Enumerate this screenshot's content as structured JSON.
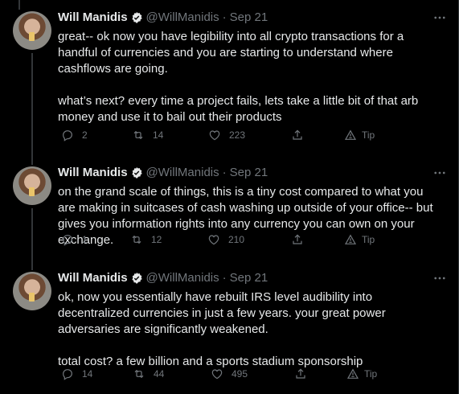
{
  "tweets": [
    {
      "name": "Will Manidis",
      "handle": "@WillManidis",
      "separator": "·",
      "date": "Sep 21",
      "text": "great-- ok now you have legibility into all crypto transactions for a handful of currencies and you are starting to understand where cashflows are going.\n\nwhat’s next? every time a project fails, lets take a little bit of that arb money and use it to bail out their products",
      "replies": "2",
      "retweets": "14",
      "likes": "223",
      "tip": "Tip"
    },
    {
      "name": "Will Manidis",
      "handle": "@WillManidis",
      "separator": "·",
      "date": "Sep 21",
      "text": "on the grand scale of things, this is a tiny cost compared to what you are making in suitcases of cash washing up outside of your office-- but gives you information rights into any currency you can own on your exchange.",
      "replies": "1",
      "retweets": "12",
      "likes": "210",
      "tip": "Tip"
    },
    {
      "name": "Will Manidis",
      "handle": "@WillManidis",
      "separator": "·",
      "date": "Sep 21",
      "text": "ok, now you essentially have rebuilt IRS level audibility into decentralized currencies in just a few years. your great power adversaries are significantly weakened.\n\ntotal cost? a few billion and a sports stadium sponsorship",
      "replies": "14",
      "retweets": "44",
      "likes": "495",
      "tip": "Tip"
    }
  ],
  "colors": {
    "background": "#000000",
    "primary_text": "#e7e9ea",
    "secondary_text": "#71767b",
    "verified": "#1d9bf0",
    "divider": "#2f3336"
  },
  "icons": {
    "verified": "verified-badge-icon",
    "more": "more-horizontal-icon",
    "reply": "reply-bubble-icon",
    "retweet": "retweet-icon",
    "like": "heart-icon",
    "share": "share-upload-icon",
    "tip": "tip-icon"
  }
}
